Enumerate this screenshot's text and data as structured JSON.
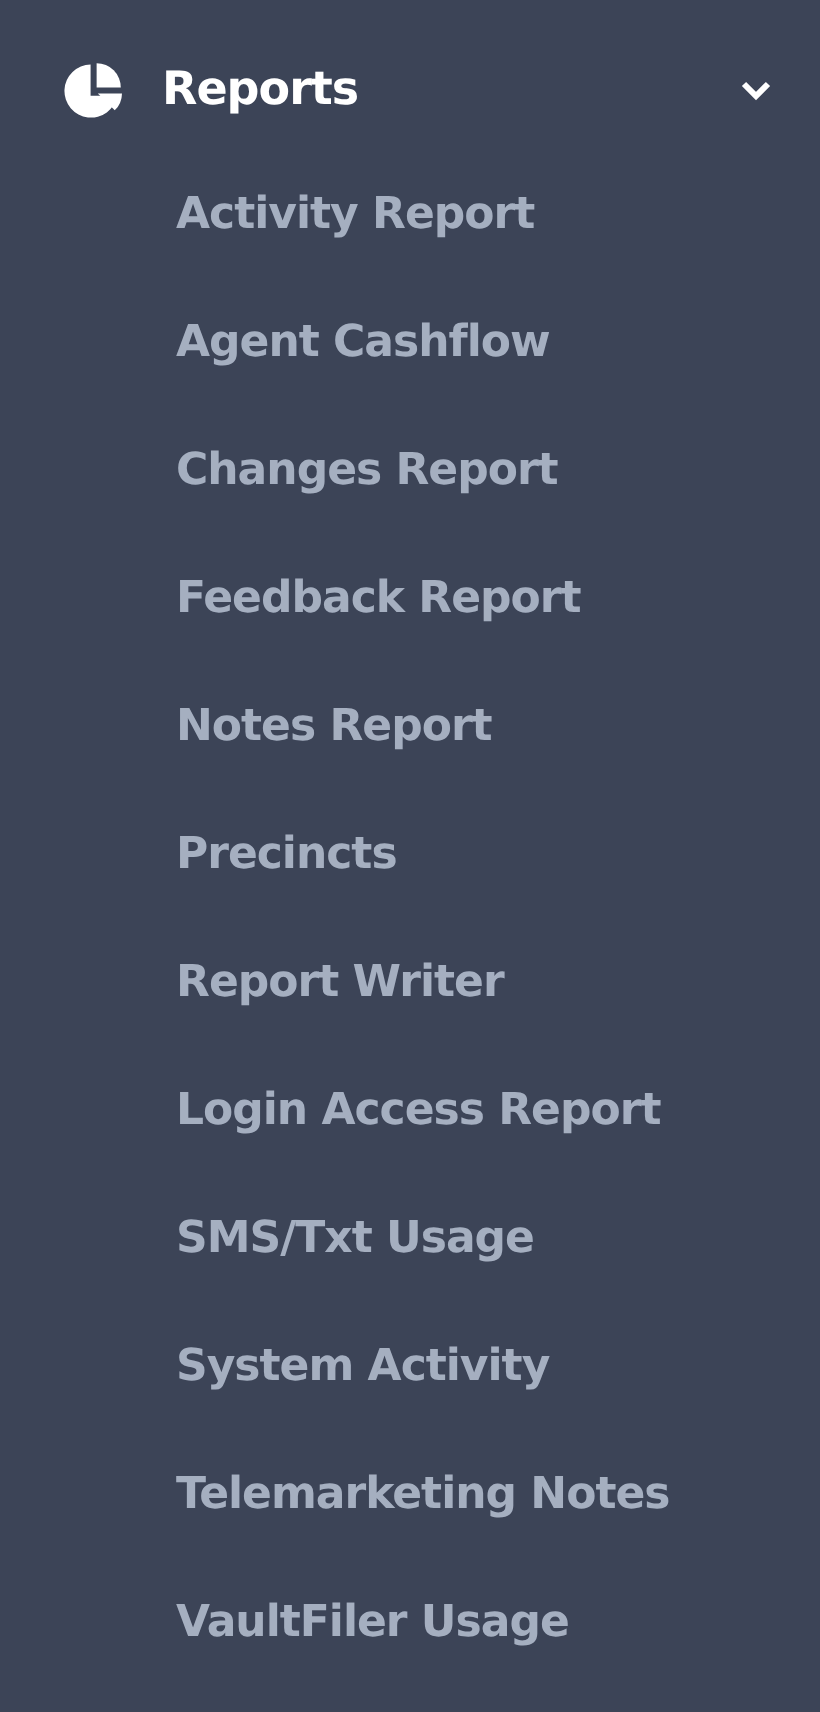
{
  "section": {
    "label": "Reports",
    "expanded": true,
    "items": [
      {
        "label": "Activity Report"
      },
      {
        "label": "Agent Cashflow"
      },
      {
        "label": "Changes Report"
      },
      {
        "label": "Feedback Report"
      },
      {
        "label": "Notes Report"
      },
      {
        "label": "Precincts"
      },
      {
        "label": "Report Writer"
      },
      {
        "label": "Login Access Report"
      },
      {
        "label": "SMS/Txt Usage"
      },
      {
        "label": "System Activity"
      },
      {
        "label": "Telemarketing Notes"
      },
      {
        "label": "VaultFiler Usage"
      }
    ]
  }
}
